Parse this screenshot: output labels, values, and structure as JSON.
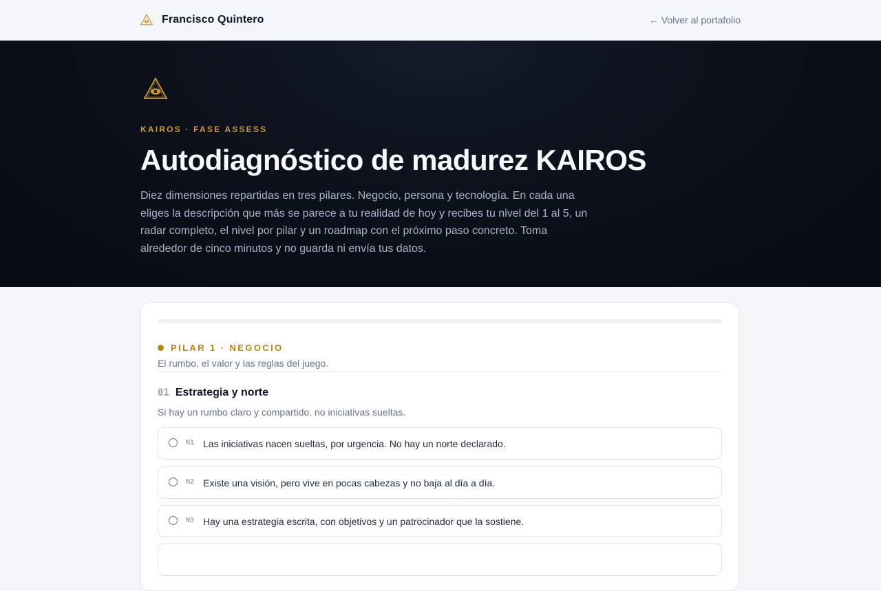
{
  "header": {
    "brand_name": "Francisco Quintero",
    "back_link": "← Volver al portafolio",
    "logo_icon": "triangle-eye-icon"
  },
  "hero": {
    "eyebrow": "KAIROS · FASE ASSESS",
    "title": "Autodiagnóstico de madurez KAIROS",
    "description": "Diez dimensiones repartidas en tres pilares. Negocio, persona y tecnología. En cada una eliges la descripción que más se parece a tu realidad de hoy y recibes tu nivel del 1 al 5, un radar completo, el nivel por pilar y un roadmap con el próximo paso concreto. Toma alrededor de cinco minutos y no guarda ni envía tus datos.",
    "logo_icon": "triangle-eye-icon"
  },
  "progress": {
    "fraction": 0
  },
  "pillar": {
    "label": "PILAR 1 · NEGOCIO",
    "subtitle": "El rumbo, el valor y las reglas del juego."
  },
  "question": {
    "number": "01",
    "title": "Estrategia y norte",
    "description": "Si hay un rumbo claro y compartido, no iniciativas sueltas.",
    "options": [
      {
        "level": "N1",
        "text": "Las iniciativas nacen sueltas, por urgencia. No hay un norte declarado."
      },
      {
        "level": "N2",
        "text": "Existe una visión, pero vive en pocas cabezas y no baja al día a día."
      },
      {
        "level": "N3",
        "text": "Hay una estrategia escrita, con objetivos y un patrocinador que la sostiene."
      }
    ]
  },
  "colors": {
    "accent": "#d49a2c",
    "pillar_accent": "#b8860b",
    "hero_bg": "#0b0f19",
    "page_bg": "#f4f6f9"
  }
}
